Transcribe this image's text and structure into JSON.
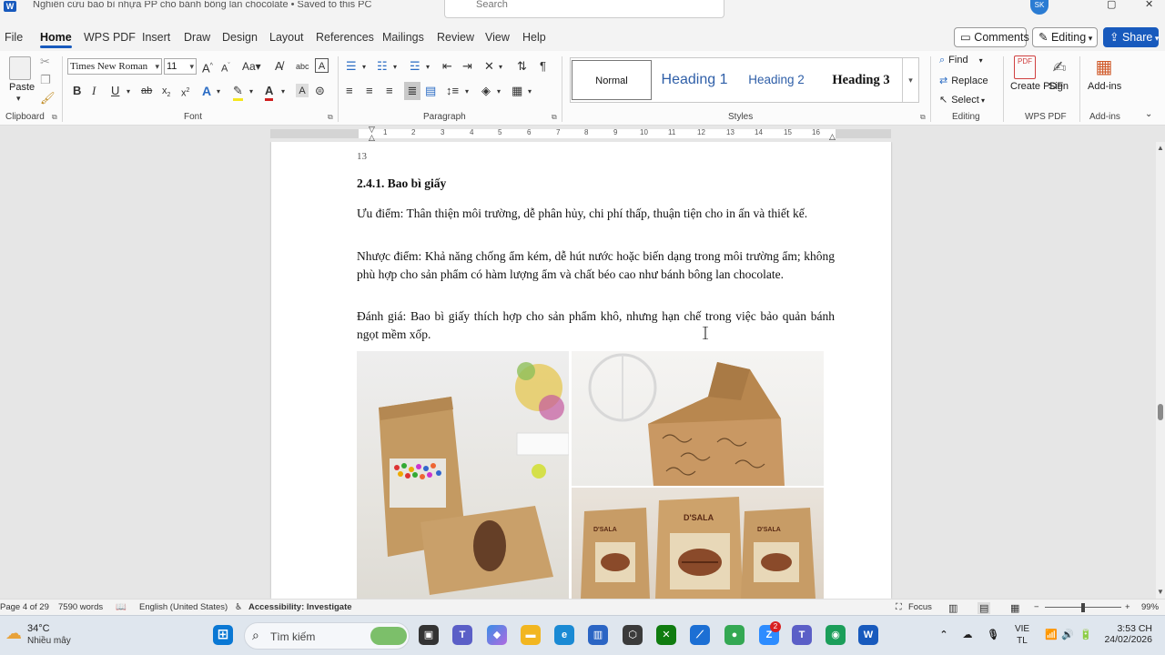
{
  "titlebar": {
    "doc_title": "Nghiên cứu bao bì nhựa PP cho bánh bông lan chocolate • Saved to this PC",
    "search_placeholder": "Search",
    "account_initials": "SK"
  },
  "menu": {
    "tabs": [
      "File",
      "Home",
      "WPS PDF",
      "Insert",
      "Draw",
      "Design",
      "Layout",
      "References",
      "Mailings",
      "Review",
      "View",
      "Help"
    ],
    "active_tab": "Home",
    "comments_label": "Comments",
    "editing_label": "Editing",
    "share_label": "Share"
  },
  "ribbon": {
    "clipboard": {
      "paste_label": "Paste",
      "group_label": "Clipboard"
    },
    "font": {
      "font_name": "Times New Roman",
      "font_size": "11",
      "group_label": "Font"
    },
    "paragraph": {
      "group_label": "Paragraph"
    },
    "styles": {
      "items": [
        "Normal",
        "Heading 1",
        "Heading 2",
        "Heading 3"
      ],
      "group_label": "Styles"
    },
    "editing": {
      "find_label": "Find",
      "replace_label": "Replace",
      "select_label": "Select",
      "group_label": "Editing"
    },
    "wps_pdf": {
      "create_pdf_label": "Create PDF",
      "sign_label": "Sign",
      "group_label": "WPS PDF"
    },
    "addins": {
      "addins_label": "Add-ins",
      "group_label": "Add-ins"
    }
  },
  "ruler": {
    "numbers": [
      "1",
      "2",
      "3",
      "4",
      "5",
      "6",
      "7",
      "8",
      "9",
      "10",
      "11",
      "12",
      "13",
      "14",
      "15",
      "16"
    ]
  },
  "document": {
    "page_number": "13",
    "heading": "2.4.1. Bao bì giấy",
    "paragraphs": [
      "Ưu điểm: Thân thiện môi trường, dễ phân hủy, chi phí thấp, thuận tiện cho in ấn và thiết kế.",
      "Nhược điểm: Khả năng chống ẩm kém, dễ hút nước hoặc biến dạng trong môi trường ẩm; không phù hợp cho sản phẩm có hàm lượng ẩm và chất béo cao như bánh bông lan chocolate.",
      "Đánh giá: Bao bì giấy thích hợp cho sản phẩm khô, nhưng hạn chế trong việc bảo quản bánh ngọt mềm xốp."
    ],
    "image_brand_text": "D'SALA"
  },
  "statusbar": {
    "page_info": "Page 4 of 29",
    "word_count": "7590 words",
    "language": "English (United States)",
    "accessibility": "Accessibility: Investigate",
    "focus_label": "Focus",
    "zoom_minus": "−",
    "zoom_plus": "+",
    "zoom_level": "99%"
  },
  "taskbar": {
    "weather_temp": "34°C",
    "weather_desc": "Nhiều mây",
    "search_placeholder": "Tìm kiếm",
    "lang_line1": "VIE",
    "lang_line2": "TL",
    "time": "3:53 CH",
    "date": "24/02/2026",
    "notification_badge": "2"
  },
  "colors": {
    "accent": "#185abd",
    "heading_blue": "#2f5fa8",
    "ribbon_bg": "#fbfbfb",
    "canvas_bg": "#e6e6e6"
  }
}
